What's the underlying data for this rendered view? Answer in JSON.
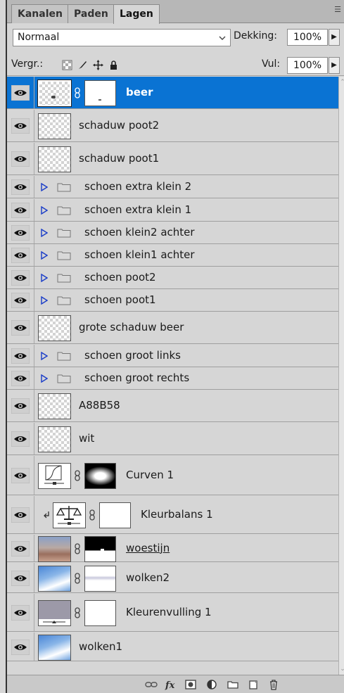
{
  "tabs": [
    {
      "label": "Kanalen"
    },
    {
      "label": "Paden"
    },
    {
      "label": "Lagen"
    }
  ],
  "blend_mode": "Normaal",
  "opacity": {
    "label": "Dekking:",
    "value": "100%"
  },
  "lock": {
    "label": "Vergr.:"
  },
  "fill": {
    "label": "Vul:",
    "value": "100%"
  },
  "layers": [
    {
      "name": "beer",
      "type": "pixel-mask",
      "selected": true
    },
    {
      "name": "schaduw poot2",
      "type": "pixel"
    },
    {
      "name": "schaduw poot1",
      "type": "pixel"
    },
    {
      "name": "schoen extra klein 2",
      "type": "group"
    },
    {
      "name": "schoen extra klein 1",
      "type": "group"
    },
    {
      "name": "schoen klein2 achter",
      "type": "group"
    },
    {
      "name": "schoen klein1 achter",
      "type": "group"
    },
    {
      "name": "schoen poot2",
      "type": "group"
    },
    {
      "name": "schoen poot1",
      "type": "group"
    },
    {
      "name": "grote schaduw beer",
      "type": "pixel"
    },
    {
      "name": "schoen groot links",
      "type": "group"
    },
    {
      "name": "schoen groot rechts",
      "type": "group"
    },
    {
      "name": "A88B58",
      "type": "pixel"
    },
    {
      "name": "wit",
      "type": "pixel"
    },
    {
      "name": "Curven 1",
      "type": "curves-adjustment"
    },
    {
      "name": "Kleurbalans 1",
      "type": "color-balance-adjustment",
      "clipped": true
    },
    {
      "name": "woestijn",
      "type": "image-mask"
    },
    {
      "name": "wolken2",
      "type": "image-mask"
    },
    {
      "name": "Kleurenvulling 1",
      "type": "fill-adjustment"
    },
    {
      "name": "wolken1",
      "type": "image"
    }
  ],
  "colors": {
    "selection": "#0a73d3",
    "panel": "#d6d6d6"
  },
  "bottom_icons": [
    "link-icon",
    "fx-icon",
    "mask-icon",
    "adjustment-icon",
    "folder-icon",
    "new-layer-icon",
    "trash-icon"
  ]
}
